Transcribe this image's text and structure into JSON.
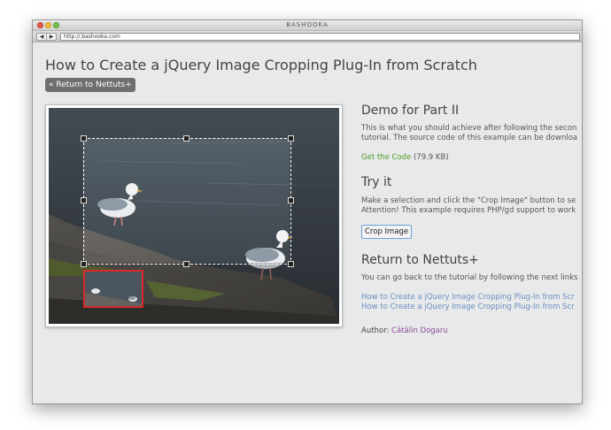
{
  "window": {
    "title": "BASHOOKA",
    "url": "http://.bashooka.com",
    "back": "◀",
    "forward": "▶"
  },
  "page": {
    "title": "How to Create a jQuery Image Cropping Plug-In from Scratch",
    "return_button": "« Return to Nettuts+"
  },
  "demo": {
    "heading": "Demo for Part II",
    "line1": "This is what you should achieve after following the secon",
    "line2": "tutorial. The source code of this example can be downloa",
    "get_code": "Get the Code",
    "code_size": " (79.9 KB)"
  },
  "try": {
    "heading": "Try it",
    "line1": "Make a selection and click the \"Crop Image\" button to se",
    "line2": "Attention! This example requires PHP/gd support to work",
    "crop_button": "Crop Image"
  },
  "return": {
    "heading": "Return to Nettuts+",
    "line1": "You can go back to the tutorial by following the next links",
    "links": [
      "How to Create a jQuery Image Cropping Plug-In from Scr",
      "How to Create a jQuery Image Cropping Plug-In from Scr"
    ]
  },
  "author": {
    "label": "Author: ",
    "name": "Cătălin Dogaru"
  },
  "colors": {
    "selection_border": "#ffffff",
    "thumb_border": "#d8282a",
    "link": "#6a8fc2",
    "code_link": "#4c9a24"
  }
}
